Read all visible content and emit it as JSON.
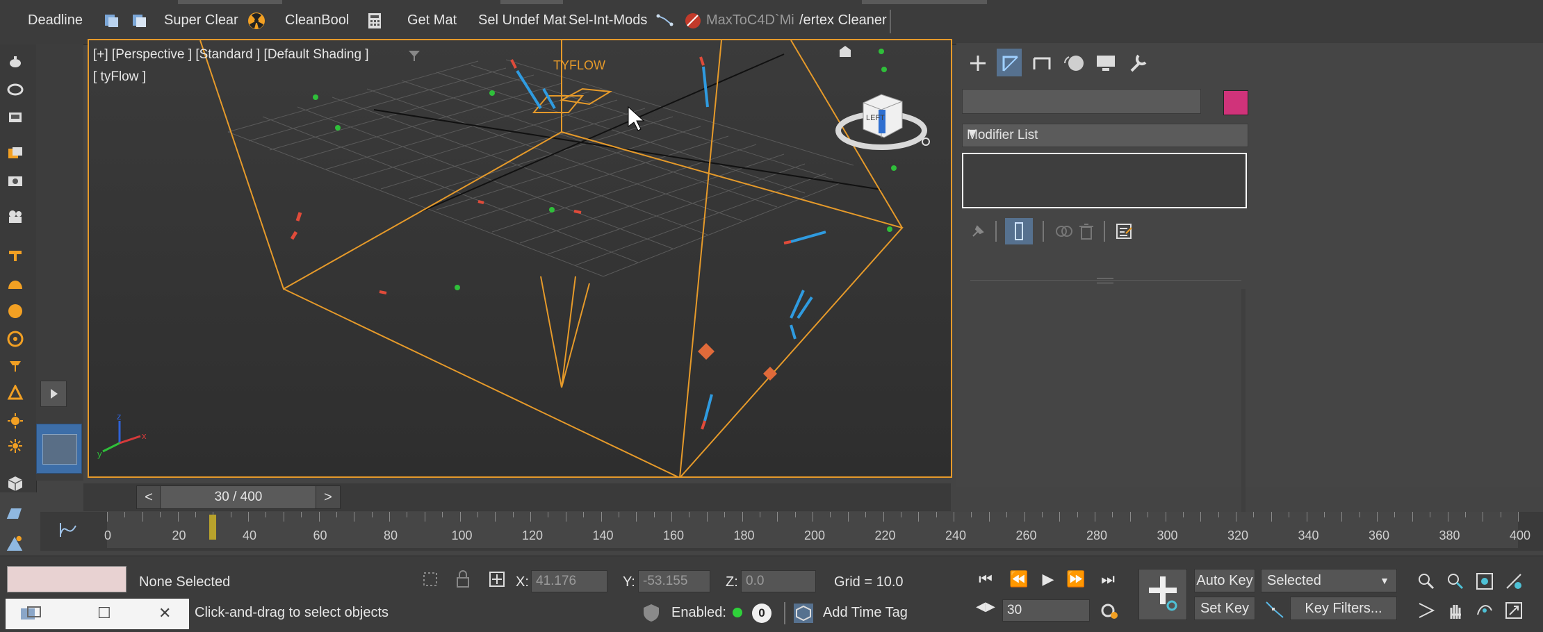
{
  "toolbar": {
    "items": [
      {
        "label": "Deadline"
      },
      {
        "label": "Super Clear"
      },
      {
        "label": "CleanBool"
      },
      {
        "label": "Get Mat"
      },
      {
        "label": "Sel Undef Mat"
      },
      {
        "label": "Sel-Int-Mods"
      },
      {
        "label": "MaxToC4D`Mi"
      },
      {
        "label": "/ertex Cleaner"
      }
    ]
  },
  "viewport": {
    "label_line1": "[+] [Perspective ] [Standard ] [Default Shading ]",
    "label_line2": "[ tyFlow ]",
    "watermark": "TYFLOW",
    "navcube_text": "LEFT"
  },
  "command_panel": {
    "tabs": [
      "create-icon",
      "modify-icon",
      "hierarchy-icon",
      "motion-icon",
      "display-icon",
      "utilities-icon"
    ],
    "object_name_value": "",
    "object_color": "#d0337a",
    "modifier_list_label": "Modifier List"
  },
  "time_slider": {
    "label": "30 / 400",
    "prev": "<",
    "next": ">"
  },
  "track_bar": {
    "current_frame": 30,
    "ticks": [
      "0",
      "20",
      "40",
      "60",
      "80",
      "100",
      "120",
      "140",
      "160",
      "180",
      "200",
      "220",
      "240",
      "260",
      "280",
      "300",
      "320",
      "340",
      "360",
      "380",
      "400"
    ]
  },
  "status": {
    "selection": "None Selected",
    "prompt": "Click-and-drag to select objects",
    "x_label": "X:",
    "x_value": "41.176",
    "y_label": "Y:",
    "y_value": "-53.155",
    "z_label": "Z:",
    "z_value": "0.0",
    "grid": "Grid = 10.0",
    "enabled_label": "Enabled:",
    "enabled_count": "0",
    "add_time_tag": "Add Time Tag",
    "auto_key": "Auto Key",
    "set_key": "Set Key",
    "selected_dropdown": "Selected",
    "frame_field": "30",
    "key_filters": "Key Filters..."
  }
}
